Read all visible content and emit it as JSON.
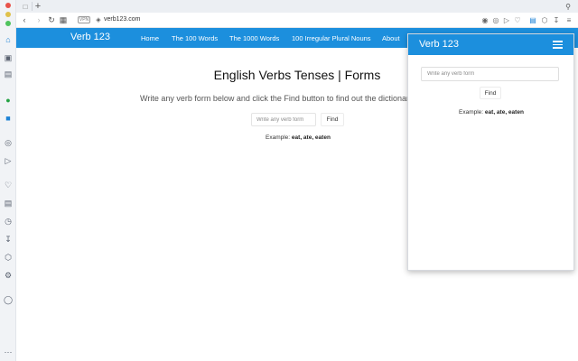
{
  "browser": {
    "url": "verb123.com",
    "vpn_label": "VPN"
  },
  "site": {
    "brand": "Verb 123",
    "nav": [
      {
        "label": "Home"
      },
      {
        "label": "The 100 Words"
      },
      {
        "label": "The 1000 Words"
      },
      {
        "label": "100 Irregular Plural Nouns"
      },
      {
        "label": "About"
      }
    ],
    "heading": "English Verbs Tenses | Forms",
    "instructions": "Write any verb form below and click the Find button to find out the dictionary",
    "search": {
      "placeholder": "Write any verb form",
      "button": "Find"
    },
    "example": {
      "label": "Example:",
      "value": "eat, ate, eaten"
    }
  },
  "popup": {
    "brand": "Verb 123",
    "search": {
      "placeholder": "Write any verb form",
      "button": "Find"
    },
    "example": {
      "label": "Example:",
      "value": "eat, ate, eaten"
    }
  },
  "colors": {
    "brand_blue": "#1c8fdd",
    "sidebar_bg": "#f1f3f6"
  },
  "icons": {
    "sidebar": [
      "home-icon",
      "briefcase-icon",
      "whatsapp-icon",
      "twitter-icon",
      "speed-dial-icon",
      "send-icon",
      "heart-icon",
      "news-icon",
      "history-icon",
      "downloads-icon",
      "extensions-icon",
      "settings-icon",
      "lightbulb-icon",
      "more-icon"
    ]
  }
}
